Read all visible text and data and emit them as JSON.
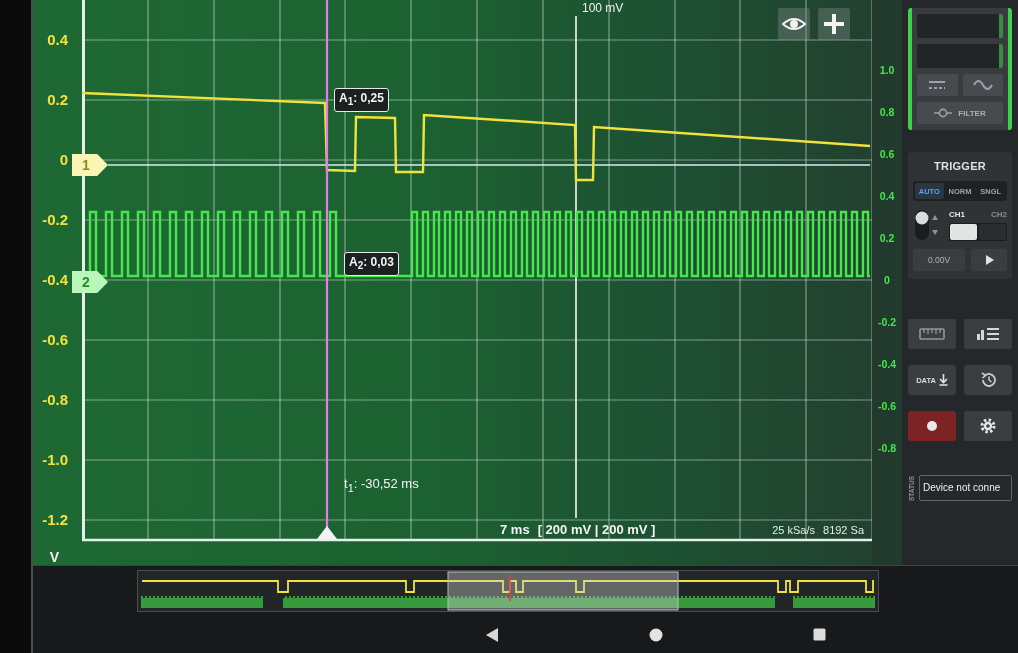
{
  "plot": {
    "top_label": "100 mV",
    "time_readout": "t$_{1}$: -30,52 ms",
    "timebase": "7 ms",
    "scales": "[ 200 mV | 200 mV ]",
    "sample_rate": "25 kSa/s",
    "sample_count": "8192 Sa"
  },
  "channels": [
    {
      "marker": "1",
      "color": "#f2e23c",
      "readout": "A$_{1}$: 0,25"
    },
    {
      "marker": "2",
      "color": "#45e84a",
      "readout": "A$_{2}$: 0,03"
    }
  ],
  "left_axis": {
    "ticks": [
      "0.4",
      "0.2",
      "0",
      "-0.2",
      "-0.4",
      "-0.6",
      "-0.8",
      "-1.0",
      "-1.2"
    ],
    "unit": "V"
  },
  "right_axis": {
    "ticks": [
      "1.0",
      "0.8",
      "0.6",
      "0.4",
      "0.2",
      "0",
      "-0.2",
      "-0.4",
      "-0.6",
      "-0.8"
    ]
  },
  "channel_panel": {
    "filter_label": "FILTER"
  },
  "trigger": {
    "title": "TRIGGER",
    "modes": [
      {
        "label": "AUTO",
        "selected": true
      },
      {
        "label": "NORM",
        "selected": false
      },
      {
        "label": "SNGL",
        "selected": false
      }
    ],
    "sources": [
      {
        "label": "CH1",
        "selected": true
      },
      {
        "label": "CH2",
        "selected": false
      }
    ],
    "level": "0.00V"
  },
  "tools": {
    "data_label": "DATA"
  },
  "status": {
    "label": "STATUS",
    "text": "Device not conne"
  }
}
